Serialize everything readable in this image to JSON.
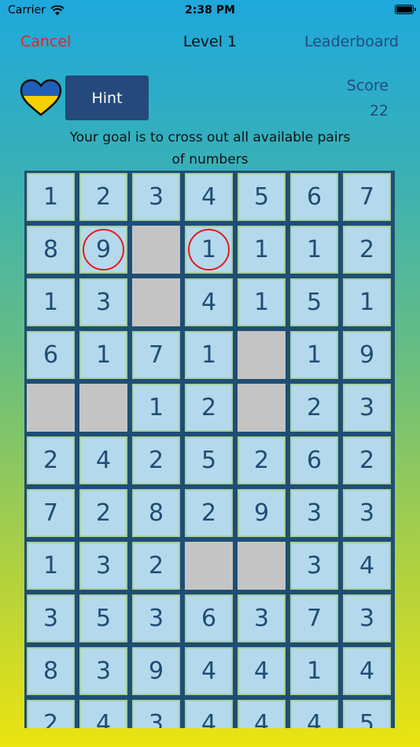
{
  "status_bar": {
    "carrier": "Carrier",
    "time": "2:38 PM"
  },
  "nav": {
    "cancel": "Cancel",
    "title": "Level 1",
    "leaderboard": "Leaderboard"
  },
  "hint_label": "Hint",
  "score": {
    "label": "Score",
    "value": "22"
  },
  "goal_line1": "Your goal is to cross out all available pairs",
  "goal_line2": "of numbers",
  "colors": {
    "cancel": "#e8231e",
    "accent": "#234b80",
    "hint_bg": "#24497a",
    "cell": "#b5d9ec",
    "empty_cell": "#c4c4c4",
    "selection": "#e51a1a",
    "flag_blue": "#1f5fb8",
    "flag_yellow": "#f5d000"
  },
  "grid": {
    "rows": [
      [
        "1",
        "2",
        "3",
        "4",
        "5",
        "6",
        "7"
      ],
      [
        "8",
        "9",
        "",
        "1",
        "1",
        "1",
        "2"
      ],
      [
        "1",
        "3",
        "",
        "4",
        "1",
        "5",
        "1"
      ],
      [
        "6",
        "1",
        "7",
        "1",
        "",
        "1",
        "9"
      ],
      [
        "",
        "",
        "1",
        "2",
        "",
        "2",
        "3"
      ],
      [
        "2",
        "4",
        "2",
        "5",
        "2",
        "6",
        "2"
      ],
      [
        "7",
        "2",
        "8",
        "2",
        "9",
        "3",
        "3"
      ],
      [
        "1",
        "3",
        "2",
        "",
        "",
        "3",
        "4"
      ],
      [
        "3",
        "5",
        "3",
        "6",
        "3",
        "7",
        "3"
      ],
      [
        "8",
        "3",
        "9",
        "4",
        "4",
        "1",
        "4"
      ],
      [
        "2",
        "4",
        "3",
        "4",
        "4",
        "4",
        "5"
      ]
    ],
    "selected": [
      [
        1,
        1
      ],
      [
        1,
        3
      ]
    ]
  }
}
